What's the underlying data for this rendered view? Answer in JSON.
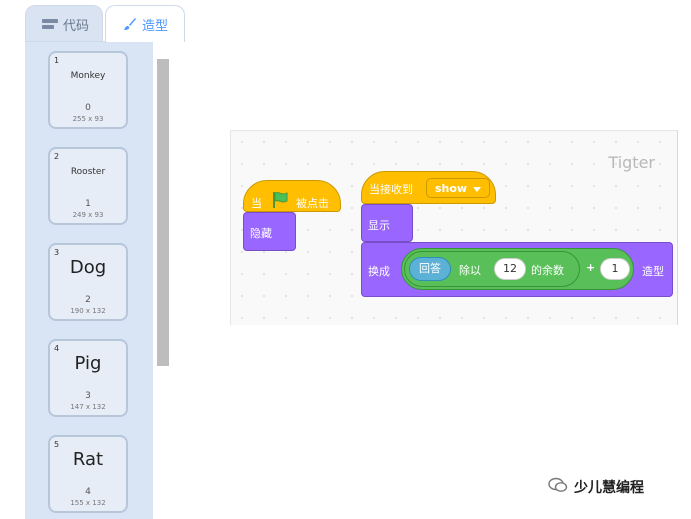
{
  "tabs": {
    "code": "代码",
    "costumes": "造型"
  },
  "costumes": [
    {
      "index": "1",
      "name": "Monkey",
      "number": "0",
      "size": "255 x 93",
      "large": false
    },
    {
      "index": "2",
      "name": "Rooster",
      "number": "1",
      "size": "249 x 93",
      "large": false
    },
    {
      "index": "3",
      "name": "Dog",
      "number": "2",
      "size": "190 x 132",
      "large": true
    },
    {
      "index": "4",
      "name": "Pig",
      "number": "3",
      "size": "147 x 132",
      "large": true
    },
    {
      "index": "5",
      "name": "Rat",
      "number": "4",
      "size": "155 x 132",
      "large": true
    }
  ],
  "script": {
    "sprite_name": "Tigter",
    "flag_hat": {
      "prefix": "当",
      "suffix": "被点击"
    },
    "hide": "隐藏",
    "receive_hat": {
      "label": "当接收到",
      "message": "show"
    },
    "show": "显示",
    "switch_costume": {
      "label": "换成",
      "answer": "回答",
      "mod": "除以",
      "divisor": "12",
      "remainder": "的余数",
      "plus": "+",
      "addend": "1",
      "suffix": "造型"
    }
  },
  "watermark": "少儿慧编程",
  "colors": {
    "event": "#ffbf00",
    "looks": "#9966ff",
    "operators": "#59c059",
    "sensing": "#5cb1d6",
    "accent": "#4c97ff"
  }
}
